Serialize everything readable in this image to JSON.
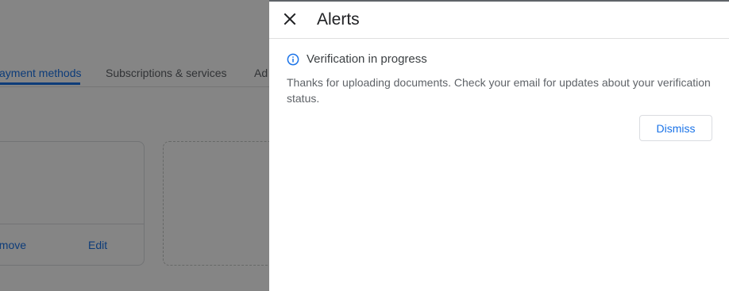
{
  "background": {
    "tabs": [
      {
        "label": "ayment methods",
        "active": true
      },
      {
        "label": "Subscriptions & services",
        "active": false
      },
      {
        "label": "Ad",
        "active": false
      }
    ],
    "card": {
      "remove_label": "emove",
      "edit_label": "Edit"
    }
  },
  "panel": {
    "title": "Alerts",
    "close_icon": "close-icon",
    "alert": {
      "icon": "info-icon",
      "title": "Verification in progress",
      "body": "Thanks for uploading documents. Check your email for updates about your verification status.",
      "dismiss_label": "Dismiss"
    }
  },
  "colors": {
    "accent": "#1a73e8",
    "scrim": "rgba(0,0,0,0.48)",
    "text_primary": "#202124",
    "text_secondary": "#5f6368"
  }
}
